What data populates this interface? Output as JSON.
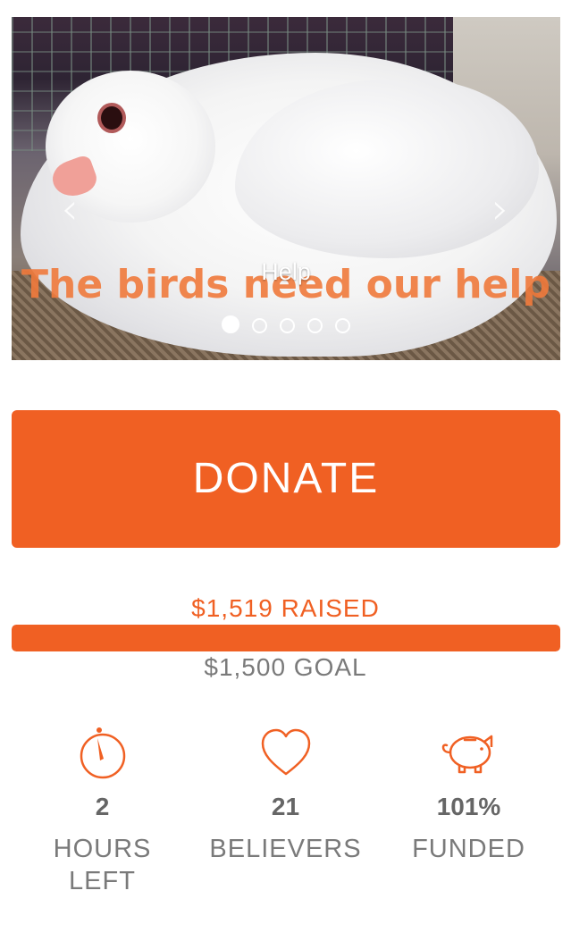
{
  "carousel": {
    "slide_caption": "Help",
    "slide_watermark": "The birds need our help",
    "slide_count": 5,
    "active_slide": 0
  },
  "donate": {
    "label": "DONATE"
  },
  "campaign": {
    "raised_text": "$1,519 RAISED",
    "goal_text": "$1,500 GOAL",
    "progress_fraction": 1.0
  },
  "stats": [
    {
      "icon": "stopwatch-icon",
      "value": "2",
      "label": "HOURS\nLEFT"
    },
    {
      "icon": "heart-icon",
      "value": "21",
      "label": "BELIEVERS"
    },
    {
      "icon": "piggy-bank-icon",
      "value": "101%",
      "label": "FUNDED"
    }
  ],
  "colors": {
    "accent": "#f06023",
    "stat_text": "#7a7a7a"
  }
}
